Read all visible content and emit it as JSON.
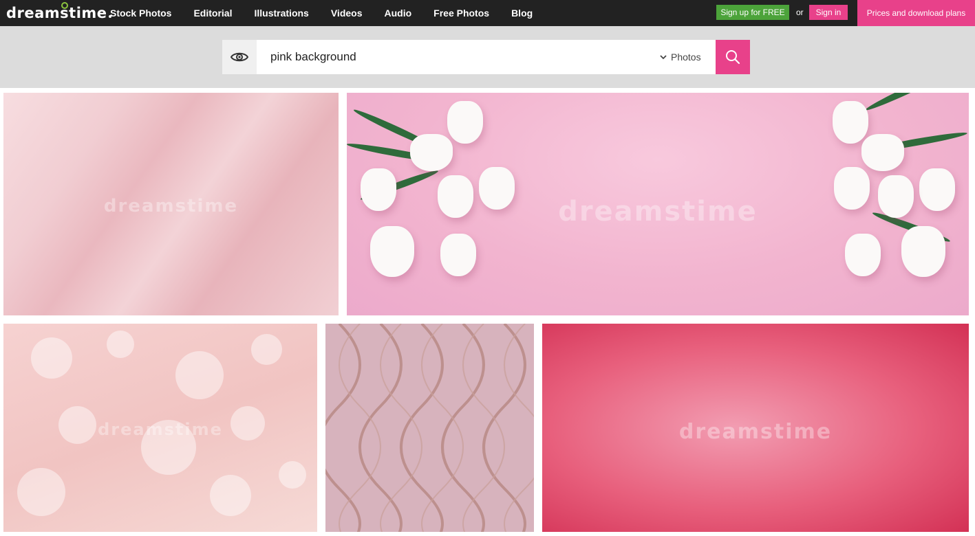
{
  "header": {
    "logo": "dreamstime",
    "nav": [
      "Stock Photos",
      "Editorial",
      "Illustrations",
      "Videos",
      "Audio",
      "Free Photos",
      "Blog"
    ],
    "signup_label": "Sign up for FREE",
    "or_label": "or",
    "signin_label": "Sign in",
    "prices_label": "Prices and download plans"
  },
  "search": {
    "query": "pink background",
    "type_label": "Photos"
  },
  "colors": {
    "topbar": "#222222",
    "accent_pink": "#e8418a",
    "signup_green": "#4ca33a",
    "search_band": "#dcdcdc"
  },
  "images": {
    "watermark": "dreamstime"
  }
}
